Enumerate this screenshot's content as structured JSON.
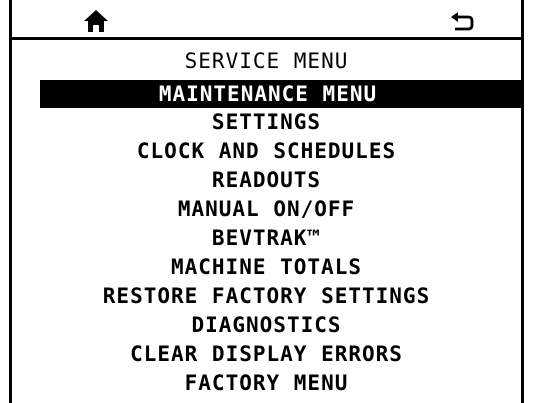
{
  "header": {
    "home_icon": "home-icon",
    "back_icon": "back-arrow-icon"
  },
  "menu": {
    "title": "SERVICE MENU",
    "selected_index": 0,
    "items": [
      {
        "label": "MAINTENANCE MENU"
      },
      {
        "label": "SETTINGS"
      },
      {
        "label": "CLOCK AND SCHEDULES"
      },
      {
        "label": "READOUTS"
      },
      {
        "label": "MANUAL ON/OFF"
      },
      {
        "label": "BEVTRAK™"
      },
      {
        "label": "MACHINE TOTALS"
      },
      {
        "label": "RESTORE FACTORY SETTINGS"
      },
      {
        "label": "DIAGNOSTICS"
      },
      {
        "label": "CLEAR DISPLAY ERRORS"
      },
      {
        "label": "FACTORY MENU"
      }
    ]
  },
  "colors": {
    "foreground": "#000000",
    "background": "#ffffff",
    "selection_bg": "#000000",
    "selection_fg": "#ffffff"
  }
}
